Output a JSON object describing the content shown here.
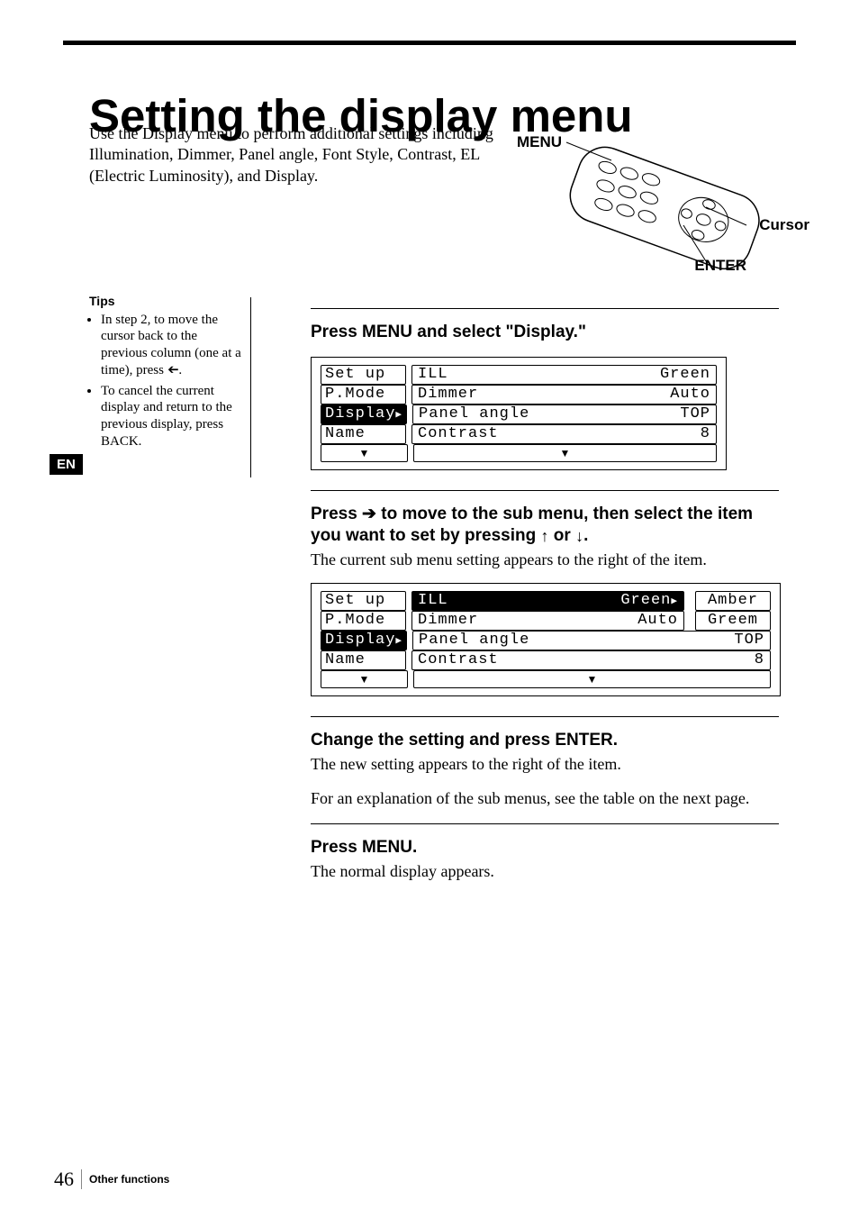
{
  "lang_badge": "EN",
  "title": "Setting the display menu",
  "intro": "Use the Display menu to perform additional settings including Illumination, Dimmer, Panel angle, Font Style, Contrast, EL (Electric Luminosity), and Display.",
  "remote_labels": {
    "menu": "MENU",
    "cursor": "Cursor",
    "enter": "ENTER"
  },
  "tips": {
    "heading": "Tips",
    "items": [
      "In step 2, to move the cursor back to the previous column (one at a time), press <.",
      "To cancel the current display and return to the previous display, press BACK."
    ]
  },
  "steps": [
    {
      "head": "Press MENU and select \"Display.\"",
      "lcd": {
        "left": [
          "Set up",
          "P.Mode",
          "Display",
          "Name"
        ],
        "mid_label": [
          "ILL",
          "Dimmer",
          "Panel angle",
          "Contrast"
        ],
        "mid_value": [
          "Green",
          "Auto",
          "TOP",
          "8"
        ],
        "selected_left_index": 2,
        "extra": null
      }
    },
    {
      "head_pre": "Press ",
      "head_post": " to move to the sub menu, then select the item you want to set by pressing ",
      "head_or": " or ",
      "head_end": ".",
      "body": "The current sub menu setting appears to the right of the item.",
      "lcd": {
        "left": [
          "Set up",
          "P.Mode",
          "Display",
          "Name"
        ],
        "mid_label": [
          "ILL",
          "Dimmer",
          "Panel angle",
          "Contrast"
        ],
        "mid_value": [
          "Green",
          "Auto",
          "TOP",
          "8"
        ],
        "selected_left_index": 2,
        "extra": [
          "Amber",
          "Greem"
        ]
      }
    },
    {
      "head": "Change the setting and press ENTER.",
      "body": "The new setting appears to the right of the item.",
      "body2": "For an explanation of the sub menus, see the table on the next page."
    },
    {
      "head": "Press MENU.",
      "body": "The normal display appears."
    }
  ],
  "footer": {
    "page": "46",
    "section": "Other functions"
  }
}
